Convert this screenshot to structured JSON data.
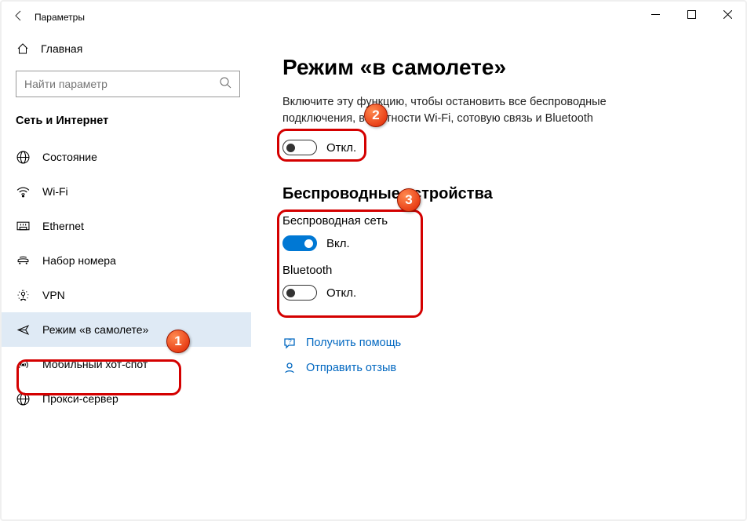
{
  "window": {
    "title": "Параметры"
  },
  "home_label": "Главная",
  "search": {
    "placeholder": "Найти параметр"
  },
  "category": "Сеть и Интернет",
  "nav": [
    {
      "label": "Состояние"
    },
    {
      "label": "Wi-Fi"
    },
    {
      "label": "Ethernet"
    },
    {
      "label": "Набор номера"
    },
    {
      "label": "VPN"
    },
    {
      "label": "Режим «в самолете»"
    },
    {
      "label": "Мобильный хот-спот"
    },
    {
      "label": "Прокси-сервер"
    }
  ],
  "page": {
    "title": "Режим «в самолете»",
    "description_line1": "Включите эту функцию, чтобы остановить все беспроводные",
    "description_line2": "подключения, в частности Wi-Fi, сотовую связь и Bluetooth",
    "airplane_toggle": {
      "state_label": "Откл.",
      "on": false
    },
    "wireless_heading": "Беспроводные устройства",
    "wifi": {
      "label": "Беспроводная сеть",
      "state_label": "Вкл.",
      "on": true
    },
    "bluetooth": {
      "label": "Bluetooth",
      "state_label": "Откл.",
      "on": false
    }
  },
  "links": {
    "help": "Получить помощь",
    "feedback": "Отправить отзыв"
  },
  "annotations": {
    "n1": "1",
    "n2": "2",
    "n3": "3"
  }
}
